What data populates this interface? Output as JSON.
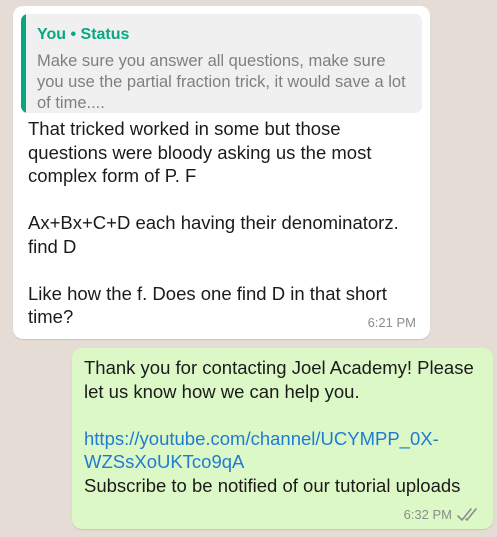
{
  "incoming_message": {
    "quote": {
      "author": "You • Status",
      "text": "Make sure you answer all questions, make sure you use the partial fraction trick, it would save a lot of time...."
    },
    "text": "That tricked worked in some but those questions were bloody asking us the most complex form of P. F\n\nAx+Bx+C+D each having their denominatorz. find D\n\nLike how the f. Does one find D in that short time?",
    "time": "6:21 PM"
  },
  "outgoing_message": {
    "text_intro": "Thank you for contacting Joel Academy! Please let us know how we can help you.\n\n",
    "link": "https://youtube.com/channel/UCYMPP_0X-WZSsXoUKTco9qA",
    "text_outro": "\nSubscribe to be notified of our tutorial uploads",
    "time": "6:32 PM",
    "status_icon": "double-check-read-icon"
  },
  "colors": {
    "background": "#e5ddd5",
    "incoming_bubble": "#ffffff",
    "outgoing_bubble": "#dcf8c6",
    "quote_accent": "#06a884",
    "link": "#1f7bd4"
  }
}
